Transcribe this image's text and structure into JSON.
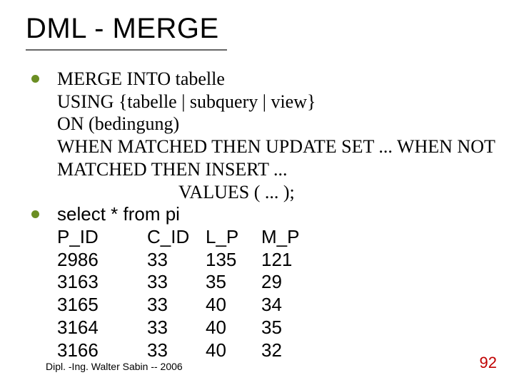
{
  "title": "DML  -  MERGE",
  "merge": {
    "l1": "MERGE INTO tabelle",
    "l2": "USING {tabelle | subquery | view}",
    "l3": "ON (bedingung)",
    "l4": "WHEN MATCHED THEN UPDATE SET ... WHEN NOT MATCHED THEN INSERT ...",
    "l5": "VALUES ( ... );"
  },
  "query": "select * from pi",
  "chart_data": {
    "type": "table",
    "columns": [
      "P_ID",
      "C_ID",
      "L_P",
      "M_P"
    ],
    "rows": [
      [
        "2986",
        "33",
        "135",
        "121"
      ],
      [
        "3163",
        "33",
        "35",
        "29"
      ],
      [
        "3165",
        "33",
        "40",
        "34"
      ],
      [
        "3164",
        "33",
        "40",
        "35"
      ],
      [
        "3166",
        "33",
        "40",
        "32"
      ]
    ]
  },
  "footer": {
    "left": "Dipl. -Ing. Walter Sabin  -- 2006",
    "right": "92"
  }
}
